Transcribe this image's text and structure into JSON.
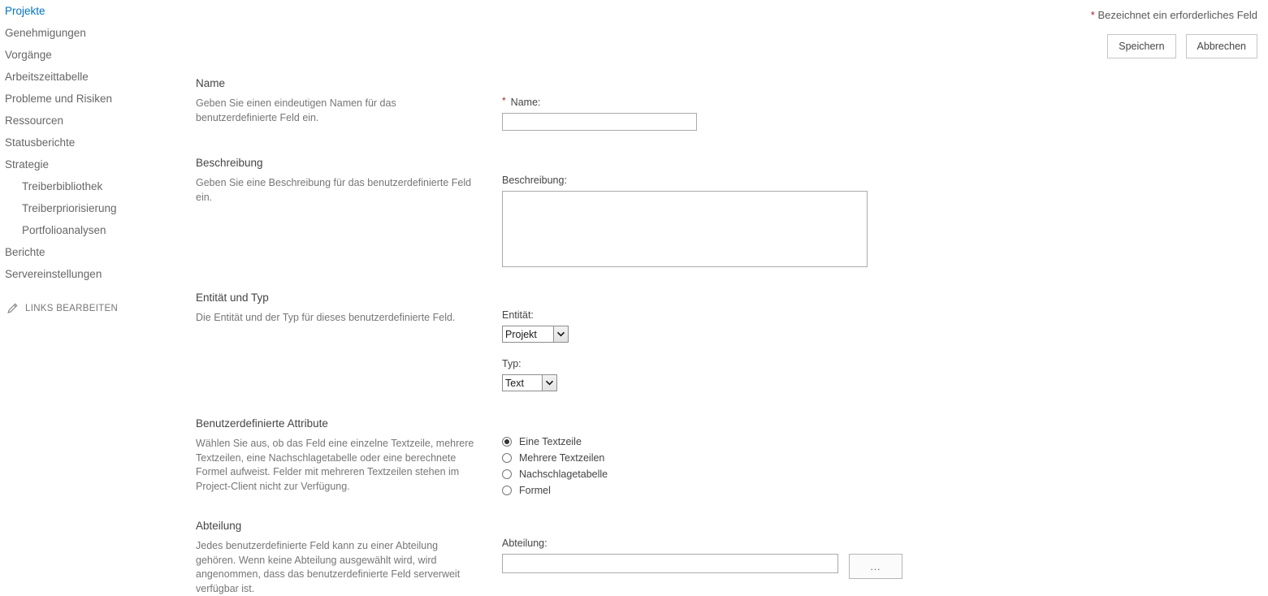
{
  "sidebar": {
    "items": [
      {
        "label": "Projekte",
        "sub": false
      },
      {
        "label": "Genehmigungen",
        "sub": false
      },
      {
        "label": "Vorgänge",
        "sub": false
      },
      {
        "label": "Arbeitszeittabelle",
        "sub": false
      },
      {
        "label": "Probleme und Risiken",
        "sub": false
      },
      {
        "label": "Ressourcen",
        "sub": false
      },
      {
        "label": "Statusberichte",
        "sub": false
      },
      {
        "label": "Strategie",
        "sub": false
      },
      {
        "label": "Treiberbibliothek",
        "sub": true
      },
      {
        "label": "Treiberpriorisierung",
        "sub": true
      },
      {
        "label": "Portfolioanalysen",
        "sub": true
      },
      {
        "label": "Berichte",
        "sub": false
      },
      {
        "label": "Servereinstellungen",
        "sub": false
      }
    ],
    "edit_links_label": "LINKS BEARBEITEN",
    "edit_links_icon": "pencil-icon"
  },
  "header": {
    "required_asterisk": "*",
    "required_note": "Bezeichnet ein erforderliches Feld",
    "save_label": "Speichern",
    "cancel_label": "Abbrechen"
  },
  "sections": {
    "name": {
      "title": "Name",
      "description": "Geben Sie einen eindeutigen Namen für das benutzerdefinierte Feld ein.",
      "field_asterisk": "*",
      "field_label": "Name:",
      "field_value": "",
      "field_placeholder": ""
    },
    "description": {
      "title": "Beschreibung",
      "description": "Geben Sie eine Beschreibung für das benutzerdefinierte Feld ein.",
      "field_label": "Beschreibung:",
      "field_value": "",
      "field_placeholder": ""
    },
    "entity_type": {
      "title": "Entität und Typ",
      "description": "Die Entität und der Typ für dieses benutzerdefinierte Feld.",
      "entity_label": "Entität:",
      "entity_value": "Projekt",
      "type_label": "Typ:",
      "type_value": "Text"
    },
    "attributes": {
      "title": "Benutzerdefinierte Attribute",
      "description": "Wählen Sie aus, ob das Feld eine einzelne Textzeile, mehrere Textzeilen, eine Nachschlagetabelle oder eine berechnete Formel aufweist. Felder mit mehreren Textzeilen stehen im Project-Client nicht zur Verfügung.",
      "options": [
        {
          "label": "Eine Textzeile",
          "checked": true
        },
        {
          "label": "Mehrere Textzeilen",
          "checked": false
        },
        {
          "label": "Nachschlagetabelle",
          "checked": false
        },
        {
          "label": "Formel",
          "checked": false
        }
      ]
    },
    "department": {
      "title": "Abteilung",
      "description": "Jedes benutzerdefinierte Feld kann zu einer Abteilung gehören. Wenn keine Abteilung ausgewählt wird, wird angenommen, dass das benutzerdefinierte Feld serverweit verfügbar ist.",
      "field_label": "Abteilung:",
      "field_value": "",
      "field_placeholder": "",
      "browse_label": "..."
    }
  },
  "colors": {
    "required_red": "#a0282d",
    "text_primary": "#444444",
    "text_muted": "#767676",
    "border": "#aaaaaa",
    "accent": "#0072c6"
  }
}
